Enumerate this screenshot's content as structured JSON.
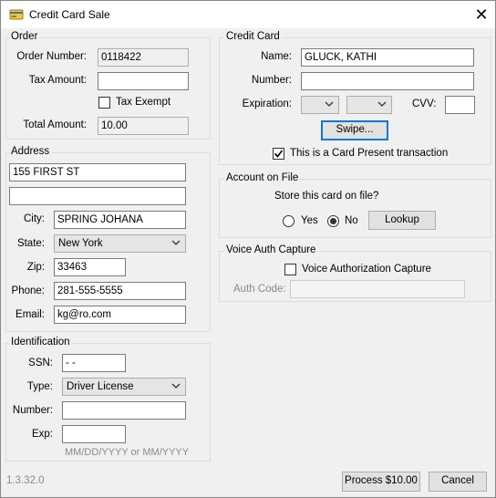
{
  "window": {
    "title": "Credit Card Sale",
    "close_glyph": "✕"
  },
  "order": {
    "legend": "Order",
    "order_number_label": "Order Number:",
    "order_number": "0118422",
    "tax_amount_label": "Tax Amount:",
    "tax_amount": "",
    "tax_exempt_label": "Tax Exempt",
    "tax_exempt_checked": false,
    "total_amount_label": "Total Amount:",
    "total_amount": "10.00"
  },
  "address": {
    "legend": "Address",
    "line1": "155 FIRST ST",
    "line2": "",
    "city_label": "City:",
    "city": "SPRING JOHANA",
    "state_label": "State:",
    "state": "New York",
    "zip_label": "Zip:",
    "zip": "33463",
    "phone_label": "Phone:",
    "phone": "281-555-5555",
    "email_label": "Email:",
    "email": "kg@ro.com"
  },
  "identification": {
    "legend": "Identification",
    "ssn_label": "SSN:",
    "ssn": "  -  -",
    "type_label": "Type:",
    "type": "Driver License",
    "number_label": "Number:",
    "number": "",
    "exp_label": "Exp:",
    "exp": "",
    "exp_hint": "MM/DD/YYYY or MM/YYYY"
  },
  "credit_card": {
    "legend": "Credit Card",
    "name_label": "Name:",
    "name": "GLUCK, KATHI",
    "number_label": "Number:",
    "number": "",
    "expiration_label": "Expiration:",
    "exp_month": "",
    "exp_year": "",
    "cvv_label": "CVV:",
    "cvv": "",
    "swipe_label": "Swipe...",
    "card_present_label": "This is a Card Present transaction",
    "card_present_checked": true
  },
  "account_on_file": {
    "legend": "Account on File",
    "prompt": "Store this card on file?",
    "yes_label": "Yes",
    "no_label": "No",
    "selected": "No",
    "lookup_label": "Lookup"
  },
  "voice_auth": {
    "legend": "Voice Auth Capture",
    "capture_label": "Voice Authorization Capture",
    "capture_checked": false,
    "auth_code_label": "Auth Code:",
    "auth_code": ""
  },
  "footer": {
    "version": "1.3.32.0",
    "process_label": "Process $10.00",
    "cancel_label": "Cancel"
  },
  "colors": {
    "accent": "#0078d7",
    "window_bg": "#f0f0f0"
  }
}
